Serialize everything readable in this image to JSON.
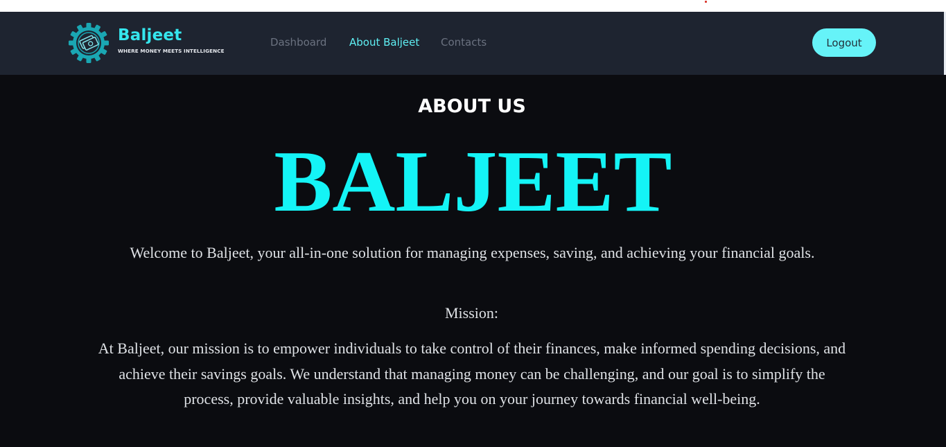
{
  "brand": {
    "name": "Baljeet",
    "tagline": "WHERE MONEY MEETS INTELLIGENCE",
    "logo_icon": "money-gear-icon"
  },
  "nav": {
    "links": [
      {
        "label": "Dashboard",
        "active": false
      },
      {
        "label": "About Baljeet",
        "active": true
      },
      {
        "label": "Contacts",
        "active": false
      }
    ],
    "logout_label": "Logout"
  },
  "main": {
    "heading": "ABOUT US",
    "hero_title": "BALJEET",
    "welcome": "Welcome to Baljeet, your all-in-one solution for managing expenses, saving, and achieving your financial goals.",
    "mission_label": "Mission:",
    "mission_text": "At Baljeet, our mission is to empower individuals to take control of their finances, make informed spending decisions, and achieve their savings goals. We understand that managing money can be challenging, and our goal is to simplify the process, provide valuable insights, and help you on your journey towards financial well-being."
  },
  "colors": {
    "navbar_bg": "#1e2430",
    "page_bg": "#0b0c10",
    "accent": "#14f4f6",
    "logout_bg": "#66f3f8",
    "nav_inactive": "#6b7280",
    "body_text": "#dfe2e6"
  }
}
